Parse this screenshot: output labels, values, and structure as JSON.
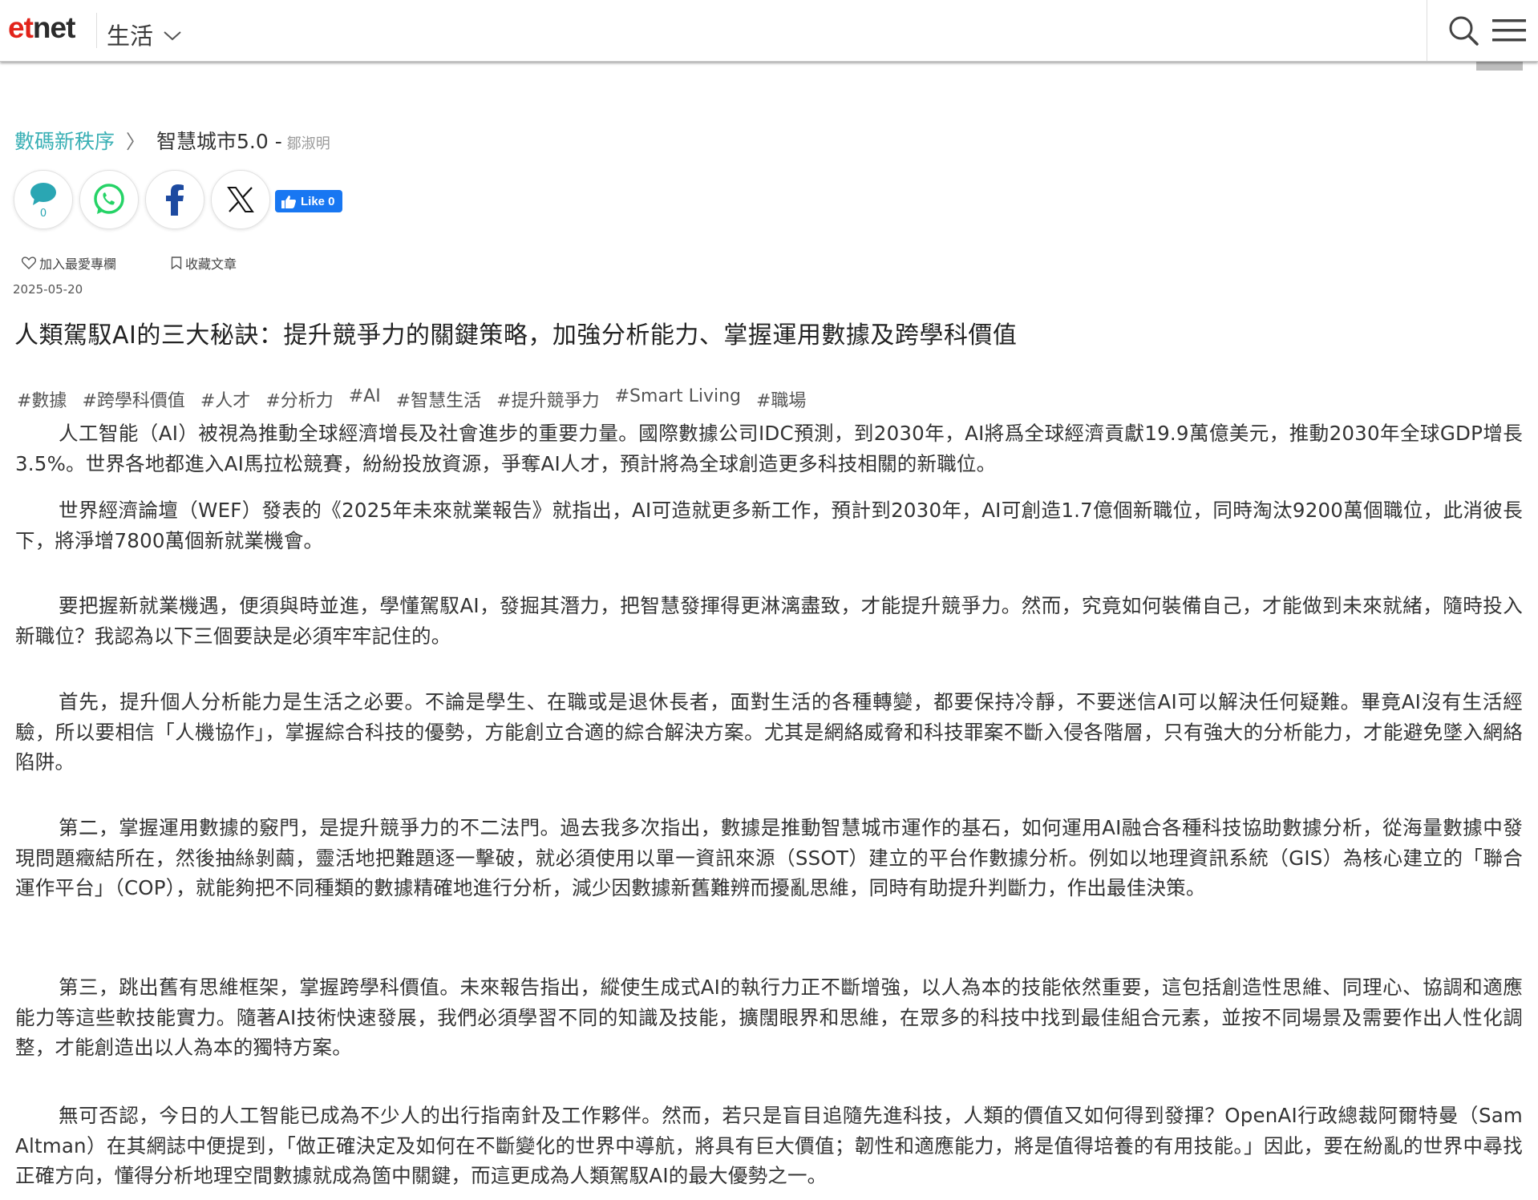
{
  "header": {
    "logo_prefix": "et",
    "logo_suffix": "net",
    "section": "生活",
    "icons": [
      "chevron-down-icon",
      "search-icon",
      "hamburger-menu-icon"
    ]
  },
  "breadcrumb": {
    "category": "數碼新秩序",
    "separator": "〉",
    "column": "智慧城市5.0 -",
    "author": "鄒淑明"
  },
  "share": {
    "comment_count": "0",
    "icons": [
      "comment-icon",
      "whatsapp-icon",
      "facebook-icon",
      "x-icon"
    ],
    "fb_like_label": "Like 0",
    "colors": {
      "comment": "#2aa6b3",
      "whatsapp": "#25d366",
      "facebook": "#1877f2"
    }
  },
  "actions": {
    "add_fav_column": "加入最愛專欄",
    "bookmark_article": "收藏文章"
  },
  "article": {
    "date": "2025-05-20",
    "title": "人類駕馭AI的三大秘訣：提升競爭力的關鍵策略，加強分析能力、掌握運用數據及跨學科價值",
    "tags": [
      "#數據",
      "#跨學科價值",
      "#人才",
      "#分析力",
      "#AI",
      "#智慧生活",
      "#提升競爭力",
      "#Smart Living",
      "#職場"
    ],
    "paragraphs": [
      "人工智能（AI）被視為推動全球經濟增長及社會進步的重要力量。國際數據公司IDC預測，到2030年，AI將爲全球經濟貢獻19.9萬億美元，推動2030年全球GDP增長3.5%。世界各地都進入AI馬拉松競賽，紛紛投放資源，爭奪AI人才，預計將為全球創造更多科技相關的新職位。",
      "世界經濟論壇（WEF）發表的《2025年未來就業報告》就指出，AI可造就更多新工作，預計到2030年，AI可創造1.7億個新職位，同時淘汰9200萬個職位，此消彼長下，將淨增7800萬個新就業機會。",
      "要把握新就業機遇，便須與時並進，學懂駕馭AI，發掘其潛力，把智慧發揮得更淋漓盡致，才能提升競爭力。然而，究竟如何裝備自己，才能做到未來就緒，隨時投入新職位？我認為以下三個要訣是必須牢牢記住的。",
      "首先，提升個人分析能力是生活之必要。不論是學生、在職或是退休長者，面對生活的各種轉變，都要保持冷靜，不要迷信AI可以解決任何疑難。畢竟AI沒有生活經驗，所以要相信「人機協作」，掌握綜合科技的優勢，方能創立合適的綜合解決方案。尤其是網絡威脅和科技罪案不斷入侵各階層，只有強大的分析能力，才能避免墜入網絡陷阱。",
      "第二，掌握運用數據的竅門，是提升競爭力的不二法門。過去我多次指出，數據是推動智慧城市運作的基石，如何運用AI融合各種科技協助數據分析，從海量數據中發現問題癥結所在，然後抽絲剝繭，靈活地把難題逐一擊破，就必須使用以單一資訊來源（SSOT）建立的平台作數據分析。例如以地理資訊系統（GIS）為核心建立的「聯合運作平台」（COP），就能夠把不同種類的數據精確地進行分析，減少因數據新舊難辨而擾亂思維，同時有助提升判斷力，作出最佳決策。",
      "第三，跳出舊有思維框架，掌握跨學科價值。未來報告指出，縱使生成式AI的執行力正不斷增強，以人為本的技能依然重要，這包括創造性思維、同理心、協調和適應能力等這些軟技能實力。隨著AI技術快速發展，我們必須學習不同的知識及技能，擴闊眼界和思維，在眾多的科技中找到最佳組合元素，並按不同場景及需要作出人性化調整，才能創造出以人為本的獨特方案。",
      "無可否認，今日的人工智能已成為不少人的出行指南針及工作夥伴。然而，若只是盲目追隨先進科技，人類的價值又如何得到發揮？OpenAI行政總裁阿爾特曼（Sam Altman）在其網誌中便提到，「做正確決定及如何在不斷變化的世界中導航，將具有巨大價值；韌性和適應能力，將是值得培養的有用技能。」因此，要在紛亂的世界中尋找正確方向，懂得分析地理空間數據就成為箇中關鍵，而這更成為人類駕馭AI的最大優勢之一。"
    ]
  }
}
